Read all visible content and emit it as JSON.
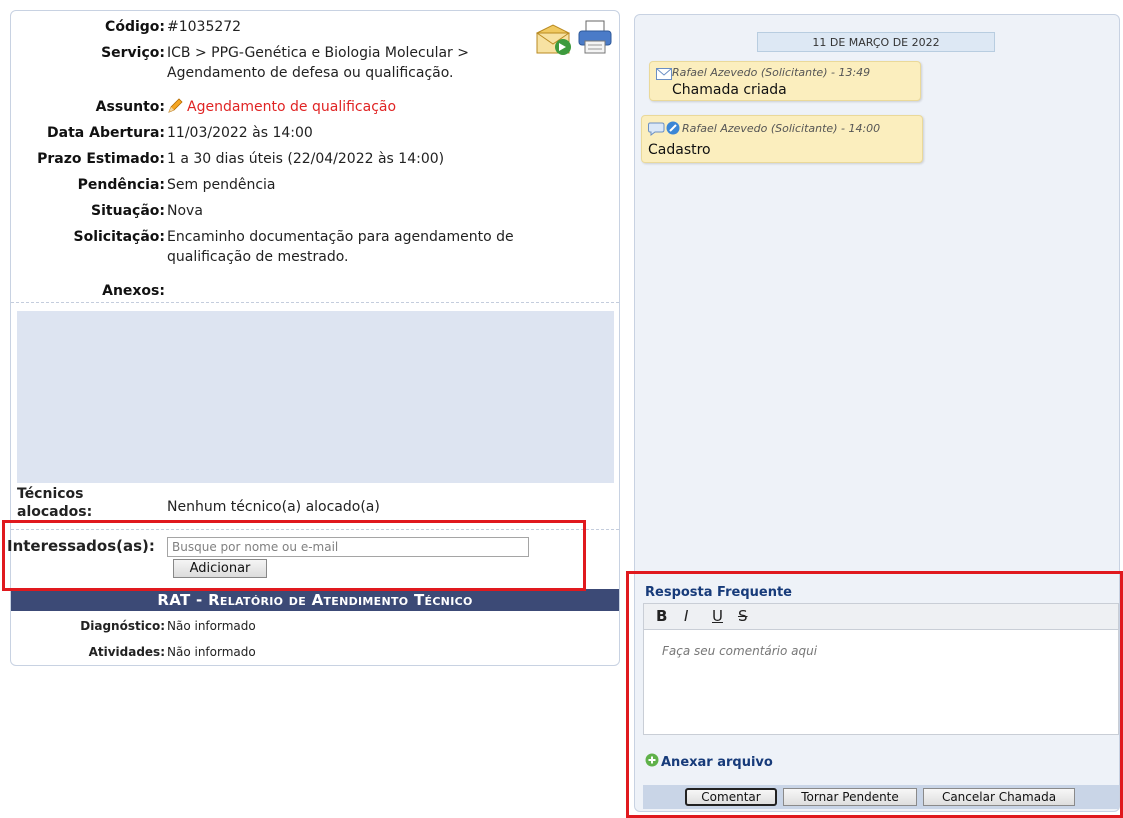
{
  "details": {
    "codigo": {
      "label": "Código:",
      "value": "#1035272"
    },
    "servico": {
      "label": "Serviço:",
      "value_line1": "ICB > PPG-Genética e Biologia Molecular >",
      "value_line2": "Agendamento de defesa ou qualificação."
    },
    "assunto": {
      "label": "Assunto:",
      "value": "Agendamento de qualificação"
    },
    "data_abertura": {
      "label": "Data Abertura:",
      "value": "11/03/2022 às 14:00"
    },
    "prazo": {
      "label": "Prazo Estimado:",
      "value": "1 a 30 dias úteis (22/04/2022 às 14:00)"
    },
    "pendencia": {
      "label": "Pendência:",
      "value": "Sem pendência"
    },
    "situacao": {
      "label": "Situação:",
      "value": "Nova"
    },
    "solicitacao": {
      "label": "Solicitação:",
      "value_line1": "Encaminho documentação para agendamento de",
      "value_line2": "qualificação de mestrado."
    },
    "anexos": {
      "label": "Anexos:"
    }
  },
  "tecnicos": {
    "label_line1": "Técnicos",
    "label_line2": "alocados:",
    "value": "Nenhum técnico(a) alocado(a)"
  },
  "interessados": {
    "label": "Interessados(as):",
    "placeholder": "Busque por nome ou e-mail",
    "add_button": "Adicionar"
  },
  "rat": {
    "title_prefix": "RAT - ",
    "title_rest": "Relatório de Atendimento Técnico",
    "diagnostico": {
      "label": "Diagnóstico:",
      "value": "Não informado"
    },
    "atividades": {
      "label": "Atividades:",
      "value": "Não informado"
    }
  },
  "timeline": {
    "date": "11 DE MARÇO DE 2022",
    "entries": [
      {
        "header": "Rafael Azevedo (Solicitante) - 13:49",
        "body": "Chamada criada",
        "icon": "envelope-icon"
      },
      {
        "header": "Rafael Azevedo (Solicitante) - 14:00",
        "body": "Cadastro",
        "icon": "comment-icon"
      }
    ]
  },
  "reply": {
    "title": "Resposta Frequente",
    "toolbar": {
      "bold": "B",
      "italic": "I",
      "underline": "U",
      "strike": "S"
    },
    "placeholder": "Faça seu comentário aqui",
    "attach": "Anexar arquivo",
    "buttons": {
      "comentar": "Comentar",
      "pendente": "Tornar Pendente",
      "cancelar": "Cancelar Chamada"
    }
  },
  "colors": {
    "assunto_red": "#e02424",
    "rat_bar": "#3c4a76",
    "highlight_red": "#e0191e",
    "link_blue": "#173b7a"
  }
}
